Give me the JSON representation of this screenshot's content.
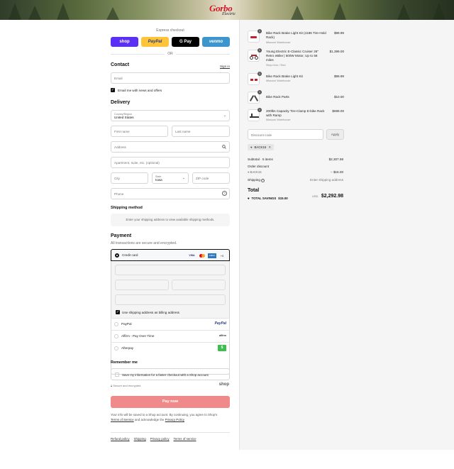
{
  "brand": {
    "name": "Gorbo",
    "subtitle": "Electric"
  },
  "express": {
    "title": "Express checkout",
    "buttons": [
      {
        "label": "shop",
        "color": "#5a31f4"
      },
      {
        "label": "PayPal",
        "color": "#ffc439"
      },
      {
        "label": "G Pay",
        "color": "#000000"
      },
      {
        "label": "venmo",
        "color": "#3d95ce"
      }
    ],
    "or": "OR"
  },
  "contact": {
    "heading": "Contact",
    "signin": "Sign in",
    "email_placeholder": "Email",
    "news_label": "Email me with news and offers"
  },
  "delivery": {
    "heading": "Delivery",
    "country_label": "Country/Region",
    "country_value": "United States",
    "first_name": "First name",
    "last_name": "Last name",
    "address": "Address",
    "apartment": "Apartment, suite, etc. (optional)",
    "city": "City",
    "state_label": "State",
    "state_value": "Iowa",
    "zip": "ZIP code",
    "phone": "Phone"
  },
  "shipping_method": {
    "heading": "Shipping method",
    "message": "Enter your shipping address to view available shipping methods."
  },
  "payment": {
    "heading": "Payment",
    "note": "All transactions are secure and encrypted.",
    "credit_card": "Credit card",
    "card_badges": [
      "VISA",
      "MC",
      "AMEX",
      "+5"
    ],
    "billing_label": "Use shipping address as billing address",
    "options": [
      {
        "label": "PayPal",
        "mark": "PayPal"
      },
      {
        "label": "Affirm - Pay Over Time",
        "mark": "affirm"
      },
      {
        "label": "Afterpay",
        "mark": "$"
      }
    ]
  },
  "remember": {
    "heading": "Remember me",
    "save_label": "Save my information for a faster checkout with a Shop account",
    "secure": "Secure and encrypted",
    "shop": "shop"
  },
  "pay_button": "Pay now",
  "legal": {
    "line1": "Your info will be saved to a Shop account. By continuing, you agree to Shop's",
    "terms": "Terms of Service",
    "mid": "and acknowledge the",
    "privacy": "Privacy Policy"
  },
  "footer_links": [
    "Refund policy",
    "Shipping",
    "Privacy policy",
    "Terms of service"
  ],
  "cart": {
    "items": [
      {
        "qty": "1",
        "title": "Bike Rack Brake Light Kit (4186 Tire-Hold Rack)",
        "sub": "Missouri Warehouse",
        "price": "$99.99"
      },
      {
        "qty": "1",
        "title": "Young Electric E-Classic Cruiser 26\" Retro eBike | 500W Motor, Up to 58 miles",
        "sub": "Step-Over / Red",
        "price": "$1,399.00"
      },
      {
        "qty": "1",
        "title": "Bike Rack Brake Light Kit",
        "sub": "Missouri Warehouse",
        "price": "$99.99"
      },
      {
        "qty": "1",
        "title": "Bike Rack Parts",
        "sub": "",
        "price": "$10.00"
      },
      {
        "qty": "1",
        "title": "200lbs Capacity Tire-Clamp E-bike Rack with Ramp",
        "sub": "Missouri Warehouse",
        "price": "$699.00"
      }
    ],
    "discount_placeholder": "Discount code",
    "apply": "Apply",
    "applied_code": "BACK15",
    "subtotal_label": "Subtotal · 5 items",
    "subtotal_value": "$2,307.98",
    "order_discount_label": "Order discount",
    "order_discount_code": "BACK15",
    "order_discount_value": "− $15.00",
    "shipping_label": "Shipping",
    "shipping_value": "Enter shipping address",
    "total_label": "Total",
    "currency": "USD",
    "total_value": "$2,292.98",
    "savings_label": "TOTAL SAVINGS",
    "savings_value": "$15.00"
  }
}
